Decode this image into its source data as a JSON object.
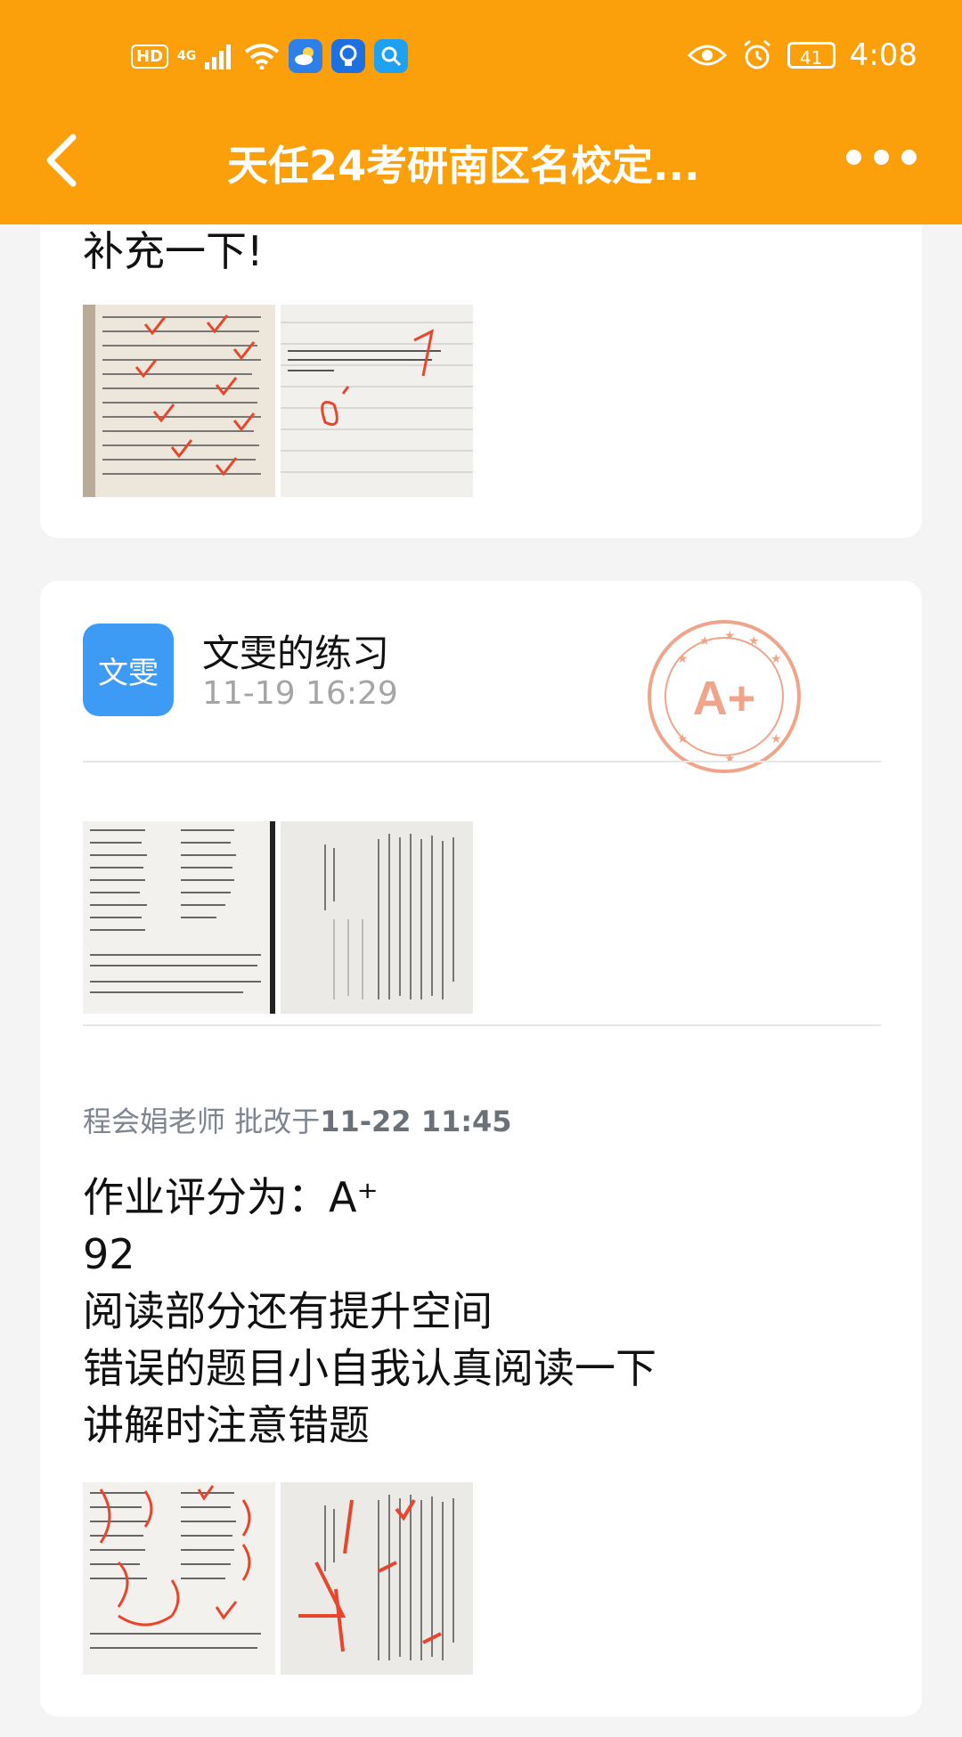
{
  "status_bar": {
    "hd": "HD",
    "net": "4G",
    "battery": "41",
    "time": "4:08"
  },
  "header": {
    "title": "天任24考研南区名校定...",
    "back_icon": "chevron-left-icon",
    "more_icon": "more-dots-icon"
  },
  "post1": {
    "text": "补充一下!"
  },
  "post2": {
    "avatar_text": "文雯",
    "author": "文雯的练习",
    "time": "11-19 16:29",
    "stamp_text": "A+"
  },
  "correction": {
    "teacher": "程会娟老师",
    "action": "批改于",
    "time": "11-22 11:45",
    "lines": [
      "作业评分为：A⁺",
      "92",
      "阅读部分还有提升空间",
      "错误的题目小自我认真阅读一下",
      "讲解时注意错题"
    ]
  },
  "colors": {
    "header": "#fb9f0b",
    "avatar": "#3d9bf5",
    "stamp": "#f0a58a",
    "mark": "#e8452c"
  }
}
